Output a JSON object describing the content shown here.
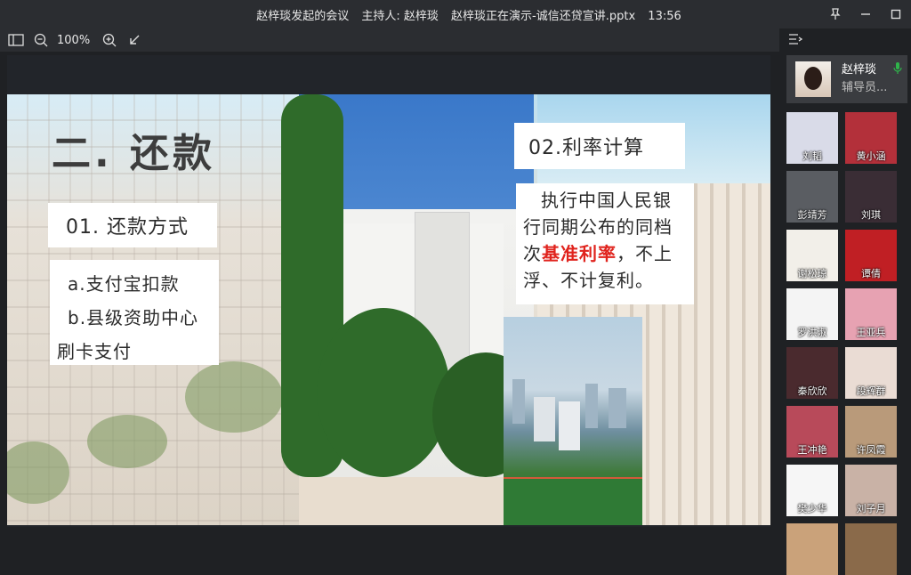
{
  "window": {
    "title_meeting": "赵梓琰发起的会议",
    "title_host": "主持人: 赵梓琰",
    "title_presenting": "赵梓琰正在演示-诚信还贷宣讲.pptx",
    "title_time": "13:56"
  },
  "toolbar": {
    "zoom": "100%"
  },
  "slide": {
    "heading": "二. 还款",
    "method_title": "01. 还款方式",
    "option_a": "a.支付宝扣款",
    "option_b": "b.县级资助中心",
    "option_b_cont": "刷卡支付",
    "rate_title": "02.利率计算",
    "rate_text_1": "执行中国人民银行同期公布的同档次",
    "rate_highlight": "基准利率",
    "rate_text_2": "，不上浮、不计复利。"
  },
  "host": {
    "name": "赵梓琰",
    "role": "辅导员..."
  },
  "participants": [
    {
      "name": "刘韬",
      "bg": "#d9dbe8"
    },
    {
      "name": "黄小涵",
      "bg": "#b3303a"
    },
    {
      "name": "彭靖芳",
      "bg": "#5a5d62"
    },
    {
      "name": "刘琪",
      "bg": "#3a2d35"
    },
    {
      "name": "谢松琼",
      "bg": "#f2efe9"
    },
    {
      "name": "谭倩",
      "bg": "#c01f24"
    },
    {
      "name": "罗洪淑",
      "bg": "#f4f4f4"
    },
    {
      "name": "王亚兵",
      "bg": "#e7a2b2"
    },
    {
      "name": "秦欣欣",
      "bg": "#4a2a2e"
    },
    {
      "name": "段辉群",
      "bg": "#eadcd4"
    },
    {
      "name": "王冲艳",
      "bg": "#b84a5a"
    },
    {
      "name": "许凤霞",
      "bg": "#b99a7a"
    },
    {
      "name": "樊少华",
      "bg": "#f6f6f6"
    },
    {
      "name": "刘子月",
      "bg": "#c9b2a6"
    },
    {
      "name": "",
      "bg": "#caa27a"
    },
    {
      "name": "",
      "bg": "#8a6a4a"
    }
  ]
}
